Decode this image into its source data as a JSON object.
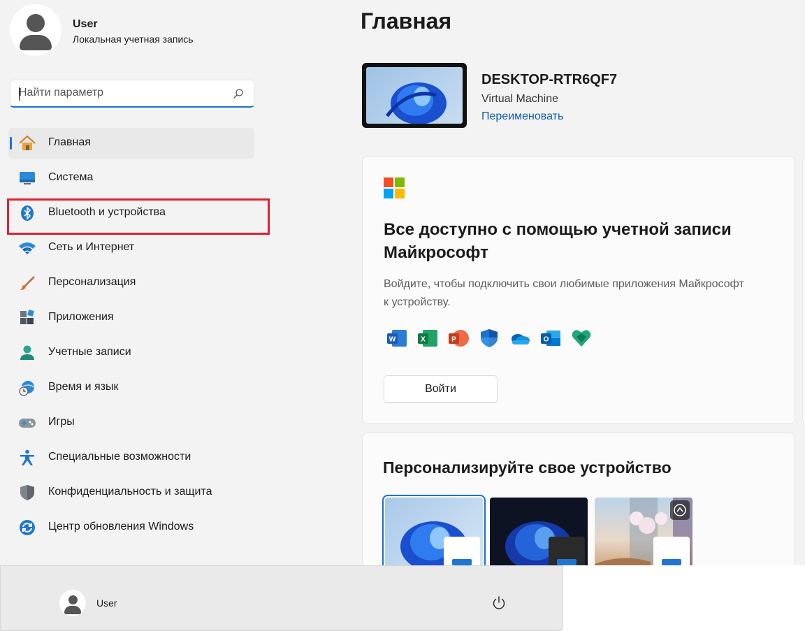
{
  "user": {
    "name": "User",
    "account_type": "Локальная учетная запись"
  },
  "search": {
    "placeholder": "Найти параметр",
    "value": ""
  },
  "nav": {
    "items": [
      {
        "label": "Главная",
        "icon": "home-icon",
        "active": true
      },
      {
        "label": "Система",
        "icon": "system-icon"
      },
      {
        "label": "Bluetooth и устройства",
        "icon": "bluetooth-icon",
        "highlighted": true
      },
      {
        "label": "Сеть и Интернет",
        "icon": "wifi-icon"
      },
      {
        "label": "Персонализация",
        "icon": "brush-icon"
      },
      {
        "label": "Приложения",
        "icon": "apps-icon"
      },
      {
        "label": "Учетные записи",
        "icon": "account-icon"
      },
      {
        "label": "Время и язык",
        "icon": "time-language-icon"
      },
      {
        "label": "Игры",
        "icon": "gamepad-icon"
      },
      {
        "label": "Специальные возможности",
        "icon": "accessibility-icon"
      },
      {
        "label": "Конфиденциальность и защита",
        "icon": "shield-icon"
      },
      {
        "label": "Центр обновления Windows",
        "icon": "update-icon"
      }
    ]
  },
  "main": {
    "title": "Главная",
    "device": {
      "name": "DESKTOP-RTR6QF7",
      "type": "Virtual Machine",
      "rename_label": "Переименовать"
    },
    "ms_card": {
      "title": "Все доступно с помощью учетной записи Майкрософт",
      "description": "Войдите, чтобы подключить свои любимые приложения Майкрософт к устройству.",
      "apps": [
        "word-icon",
        "excel-icon",
        "powerpoint-icon",
        "defender-icon",
        "onedrive-icon",
        "outlook-icon",
        "family-safety-icon"
      ],
      "signin_label": "Войти"
    },
    "personalize_card": {
      "title": "Персонализируйте свое устройство",
      "themes": [
        "theme-light",
        "theme-dark",
        "theme-spotlight"
      ]
    }
  },
  "footer": {
    "user_name": "User"
  },
  "colors": {
    "accent": "#1f6fd6",
    "highlight": "#e0212f",
    "link": "#0f5bb5"
  }
}
